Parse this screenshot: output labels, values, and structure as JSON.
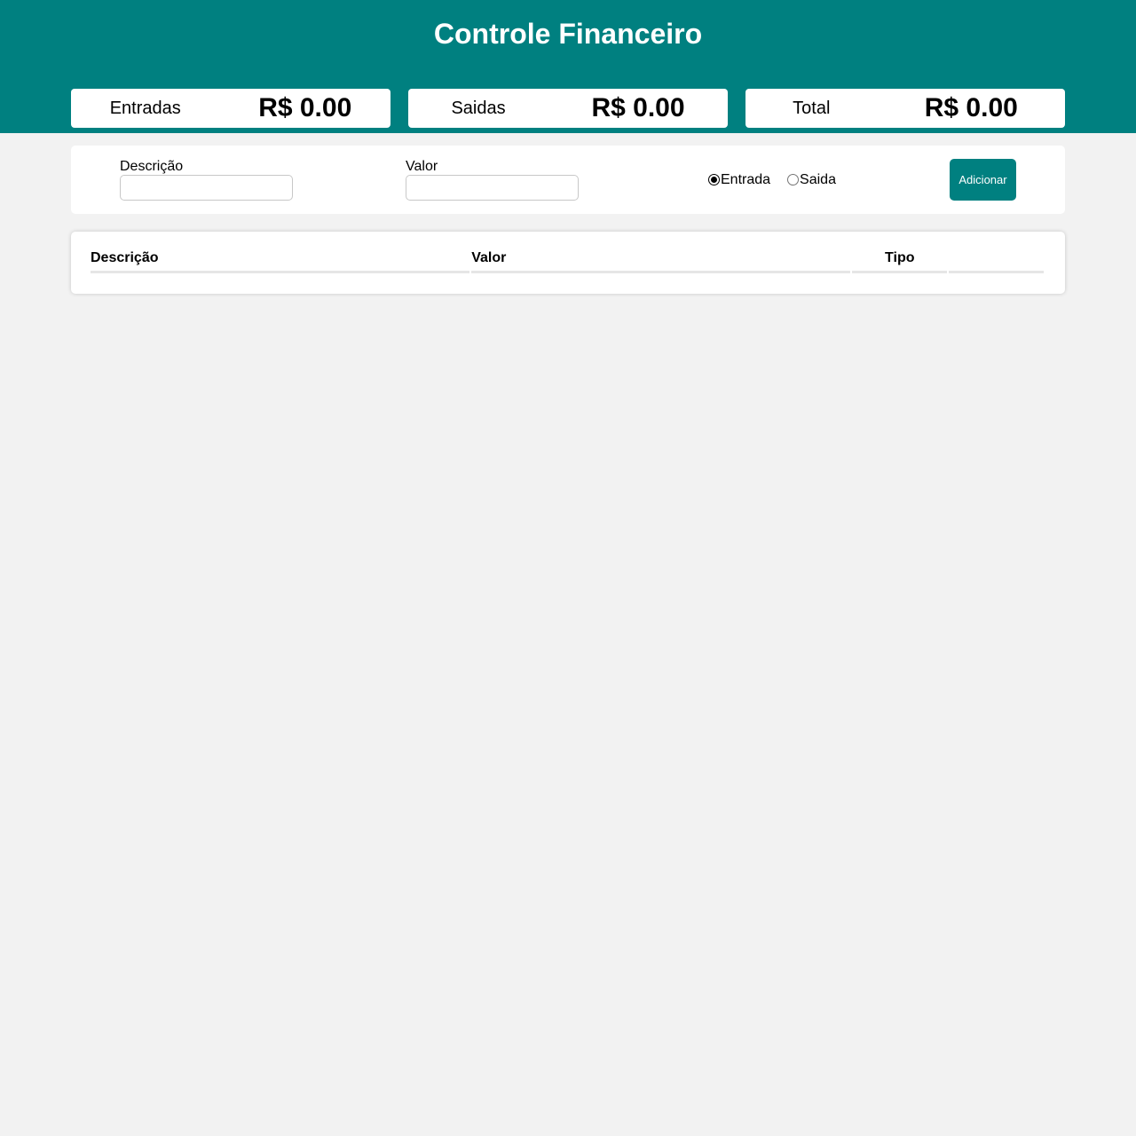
{
  "header": {
    "title": "Controle Financeiro",
    "background": "#008080"
  },
  "summary": [
    {
      "label": "Entradas",
      "value": "R$ 0.00"
    },
    {
      "label": "Saidas",
      "value": "R$ 0.00"
    },
    {
      "label": "Total",
      "value": "R$ 0.00"
    }
  ],
  "form": {
    "description_label": "Descrição",
    "description_value": "",
    "amount_label": "Valor",
    "amount_value": "",
    "type_options": [
      {
        "label": "Entrada",
        "checked": true
      },
      {
        "label": "Saida",
        "checked": false
      }
    ],
    "add_label": "Adicionar"
  },
  "table": {
    "columns": [
      "Descrição",
      "Valor",
      "Tipo",
      ""
    ],
    "rows": []
  },
  "colors": {
    "accent": "#008080",
    "page_background": "#f2f2f2"
  }
}
